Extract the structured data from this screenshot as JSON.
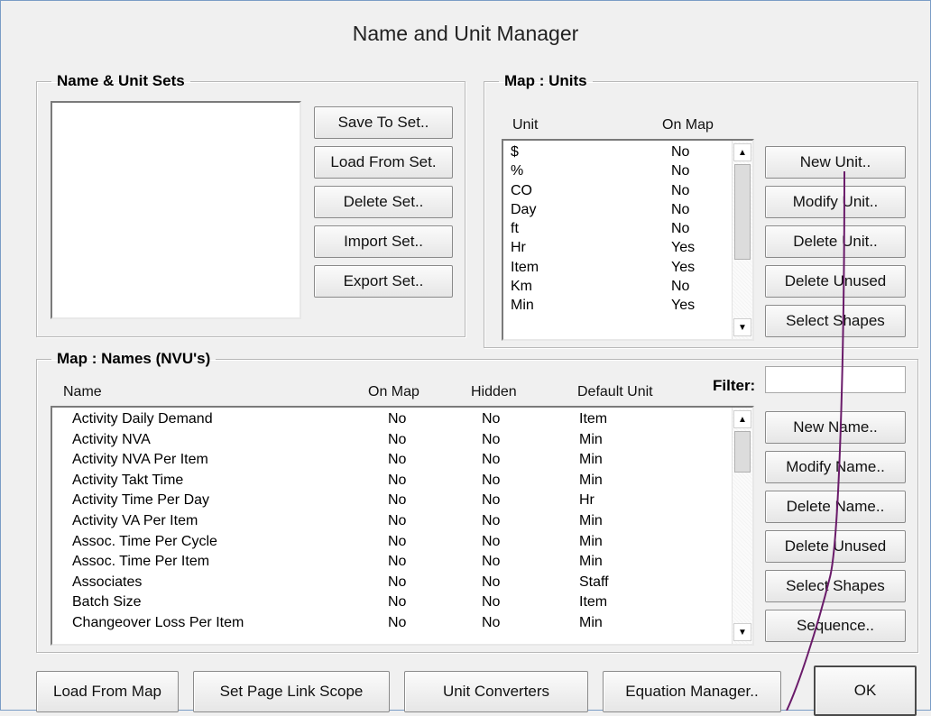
{
  "window": {
    "title": "Name and Unit Manager"
  },
  "sets": {
    "legend": "Name & Unit Sets",
    "buttons": {
      "save": "Save To Set..",
      "load": "Load From Set.",
      "delete": "Delete Set..",
      "import": "Import Set..",
      "export": "Export Set.."
    }
  },
  "units": {
    "legend": "Map : Units",
    "headers": {
      "unit": "Unit",
      "on_map": "On Map"
    },
    "rows": [
      {
        "unit": "$",
        "on_map": "No"
      },
      {
        "unit": "%",
        "on_map": "No"
      },
      {
        "unit": "CO",
        "on_map": "No"
      },
      {
        "unit": "Day",
        "on_map": "No"
      },
      {
        "unit": "ft",
        "on_map": "No"
      },
      {
        "unit": "Hr",
        "on_map": "Yes"
      },
      {
        "unit": "Item",
        "on_map": "Yes"
      },
      {
        "unit": "Km",
        "on_map": "No"
      },
      {
        "unit": "Min",
        "on_map": "Yes"
      }
    ],
    "buttons": {
      "new": "New Unit..",
      "modify": "Modify Unit..",
      "delete": "Delete Unit..",
      "delete_unused": "Delete Unused",
      "select_shapes": "Select Shapes"
    }
  },
  "names": {
    "legend": "Map : Names (NVU's)",
    "headers": {
      "name": "Name",
      "on_map": "On Map",
      "hidden": "Hidden",
      "default_unit": "Default Unit"
    },
    "filter_label": "Filter:",
    "filter_value": "",
    "rows": [
      {
        "name": "Activity Daily Demand",
        "on_map": "No",
        "hidden": "No",
        "unit": "Item"
      },
      {
        "name": "Activity NVA",
        "on_map": "No",
        "hidden": "No",
        "unit": "Min"
      },
      {
        "name": "Activity NVA Per Item",
        "on_map": "No",
        "hidden": "No",
        "unit": "Min"
      },
      {
        "name": "Activity Takt Time",
        "on_map": "No",
        "hidden": "No",
        "unit": "Min"
      },
      {
        "name": "Activity Time Per Day",
        "on_map": "No",
        "hidden": "No",
        "unit": "Hr"
      },
      {
        "name": "Activity VA Per Item",
        "on_map": "No",
        "hidden": "No",
        "unit": "Min"
      },
      {
        "name": "Assoc. Time Per Cycle",
        "on_map": "No",
        "hidden": "No",
        "unit": "Min"
      },
      {
        "name": "Assoc. Time Per Item",
        "on_map": "No",
        "hidden": "No",
        "unit": "Min"
      },
      {
        "name": "Associates",
        "on_map": "No",
        "hidden": "No",
        "unit": "Staff"
      },
      {
        "name": "Batch Size",
        "on_map": "No",
        "hidden": "No",
        "unit": "Item"
      },
      {
        "name": "Changeover Loss Per Item",
        "on_map": "No",
        "hidden": "No",
        "unit": "Min"
      }
    ],
    "buttons": {
      "new": "New Name..",
      "modify": "Modify Name..",
      "delete": "Delete Name..",
      "delete_unused": "Delete Unused",
      "select_shapes": "Select Shapes",
      "sequence": "Sequence.."
    }
  },
  "footer": {
    "load_from_map": "Load From Map",
    "set_page_link_scope": "Set Page Link Scope",
    "unit_converters": "Unit Converters",
    "equation_manager": "Equation Manager..",
    "ok": "OK"
  },
  "icons": {
    "scroll_up": "arrow-up-icon",
    "scroll_down": "arrow-down-icon"
  },
  "colors": {
    "annotation_line": "#6a1b6a",
    "window_bg": "#f0f0f0"
  }
}
